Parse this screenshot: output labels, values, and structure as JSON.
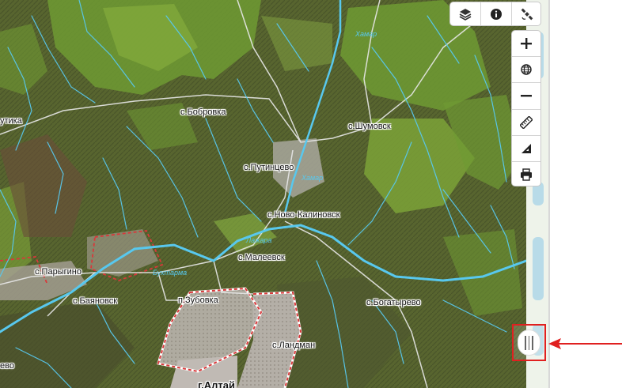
{
  "map": {
    "places": [
      {
        "id": "bobrovka",
        "label": "с.Бобровка"
      },
      {
        "id": "shumovsk",
        "label": "с.Шумовск"
      },
      {
        "id": "putintsevo",
        "label": "с.Путинцево"
      },
      {
        "id": "novo-kalinovsk",
        "label": "с.Ново-Калиновск"
      },
      {
        "id": "maleevsk",
        "label": "с.Малеевск"
      },
      {
        "id": "parygino",
        "label": "с.Парыгино"
      },
      {
        "id": "bayanovsk",
        "label": "с.Баяновск"
      },
      {
        "id": "zubovka",
        "label": "п.Зубовка"
      },
      {
        "id": "bogatyrevo",
        "label": "с.Богатырево"
      },
      {
        "id": "landman",
        "label": "с.Ландман"
      },
      {
        "id": "altay",
        "label": "г.Алтай"
      },
      {
        "id": "utika",
        "label": "утика"
      },
      {
        "id": "edge-village",
        "label": "ево"
      }
    ],
    "rivers": [
      {
        "id": "khamar-1",
        "label": "Хамар"
      },
      {
        "id": "khamar-2",
        "label": "Хамар"
      },
      {
        "id": "lazhara",
        "label": "Лажара"
      },
      {
        "id": "bukhtarma",
        "label": "Бухтарма"
      }
    ]
  },
  "toolbar": {
    "top": [
      {
        "id": "layers",
        "icon": "layers-icon",
        "title": "Layers"
      },
      {
        "id": "info",
        "icon": "info-icon",
        "title": "Info"
      },
      {
        "id": "satellite",
        "icon": "satellite-icon",
        "title": "Satellite"
      }
    ],
    "side": [
      {
        "id": "zoom-in",
        "icon": "plus-icon"
      },
      {
        "id": "globe",
        "icon": "globe-icon"
      },
      {
        "id": "zoom-out",
        "icon": "minus-icon"
      },
      {
        "id": "measure-distance",
        "icon": "ruler-icon"
      },
      {
        "id": "measure-area",
        "icon": "area-icon"
      },
      {
        "id": "print",
        "icon": "printer-icon"
      }
    ]
  },
  "panel_handle": {
    "icon": "drag-handle-icon"
  },
  "annotation": {
    "arrow_color": "#e02020"
  },
  "colors": {
    "river": "#58c8ee",
    "road": "#e8e8e8",
    "boundary": "#d9383a",
    "forest": "#6f9a33",
    "terrain": "#5b6a3a",
    "town_area": "#b6b0aa"
  }
}
